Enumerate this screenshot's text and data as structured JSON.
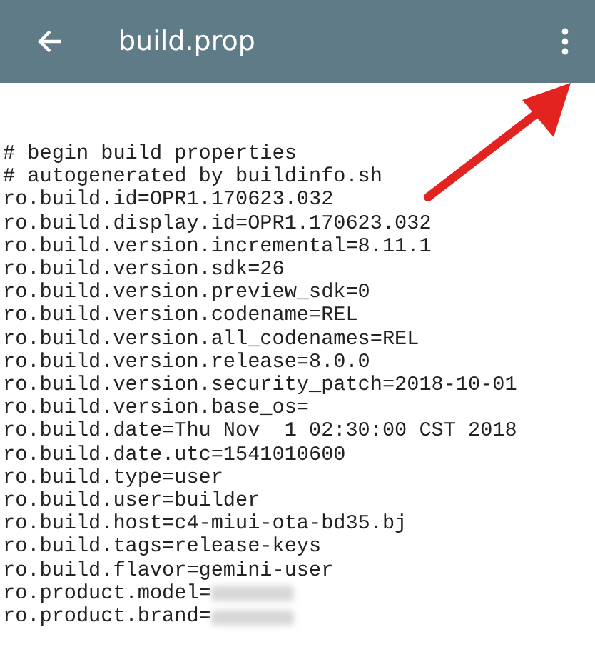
{
  "app_bar": {
    "title": "build.prop"
  },
  "lines": [
    {
      "text": "# begin build properties",
      "redacted": false
    },
    {
      "text": "# autogenerated by buildinfo.sh",
      "redacted": false
    },
    {
      "text": "ro.build.id=OPR1.170623.032",
      "redacted": false
    },
    {
      "text": "ro.build.display.id=OPR1.170623.032",
      "redacted": false
    },
    {
      "text": "ro.build.version.incremental=8.11.1",
      "redacted": false
    },
    {
      "text": "ro.build.version.sdk=26",
      "redacted": false
    },
    {
      "text": "ro.build.version.preview_sdk=0",
      "redacted": false
    },
    {
      "text": "ro.build.version.codename=REL",
      "redacted": false
    },
    {
      "text": "ro.build.version.all_codenames=REL",
      "redacted": false
    },
    {
      "text": "ro.build.version.release=8.0.0",
      "redacted": false
    },
    {
      "text": "ro.build.version.security_patch=2018-10-01",
      "redacted": false
    },
    {
      "text": "ro.build.version.base_os=",
      "redacted": false
    },
    {
      "text": "ro.build.date=Thu Nov  1 02:30:00 CST 2018",
      "redacted": false
    },
    {
      "text": "ro.build.date.utc=1541010600",
      "redacted": false
    },
    {
      "text": "ro.build.type=user",
      "redacted": false
    },
    {
      "text": "ro.build.user=builder",
      "redacted": false
    },
    {
      "text": "ro.build.host=c4-miui-ota-bd35.bj",
      "redacted": false
    },
    {
      "text": "ro.build.tags=release-keys",
      "redacted": false
    },
    {
      "text": "ro.build.flavor=gemini-user",
      "redacted": false
    },
    {
      "text": "ro.product.model=",
      "redacted": true
    },
    {
      "text": "ro.product.brand=",
      "redacted": true
    }
  ],
  "annotations": [
    {
      "kind": "arrow"
    }
  ]
}
